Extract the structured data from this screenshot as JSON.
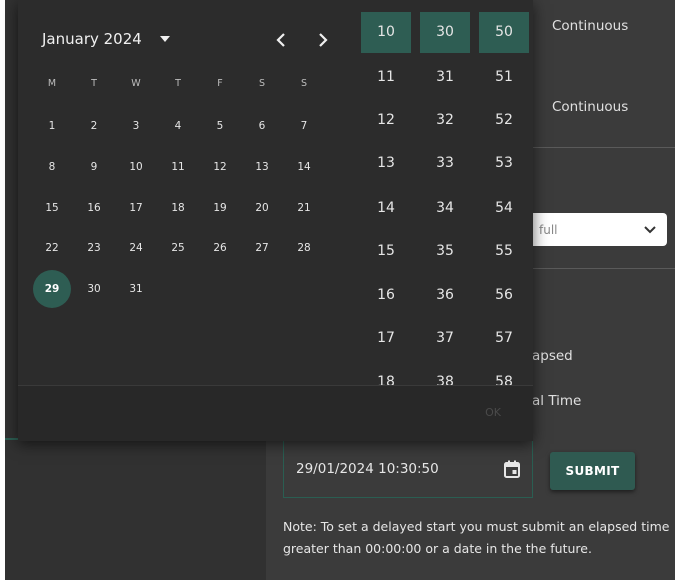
{
  "right_panel": {
    "continuous_1": "Continuous",
    "continuous_2": "Continuous",
    "select_value": "full",
    "elapsed_partial": "apsed",
    "realtime_partial": "al Time",
    "datetime_value": "29/01/2024 10:30:50",
    "submit_label": "SUBMIT",
    "note": "Note: To set a delayed start you must submit an elapsed time greater than 00:00:00 or a date in the the future."
  },
  "calendar": {
    "month_label": "January 2024",
    "weekdays": [
      "M",
      "T",
      "W",
      "T",
      "F",
      "S",
      "S"
    ],
    "days": [
      "1",
      "2",
      "3",
      "4",
      "5",
      "6",
      "7",
      "8",
      "9",
      "10",
      "11",
      "12",
      "13",
      "14",
      "15",
      "16",
      "17",
      "18",
      "19",
      "20",
      "21",
      "22",
      "23",
      "24",
      "25",
      "26",
      "27",
      "28",
      "29",
      "30",
      "31"
    ],
    "selected_day": "29"
  },
  "time": {
    "hours": [
      "10",
      "11",
      "12",
      "13",
      "14",
      "15",
      "16",
      "17",
      "18"
    ],
    "minutes": [
      "30",
      "31",
      "32",
      "33",
      "34",
      "35",
      "36",
      "37",
      "38"
    ],
    "seconds": [
      "50",
      "51",
      "52",
      "53",
      "54",
      "55",
      "56",
      "57",
      "58"
    ]
  },
  "ok_label": "OK",
  "colors": {
    "accent": "#2e5d53",
    "panel": "#3b3b3b",
    "popup": "#2c2c2c"
  }
}
